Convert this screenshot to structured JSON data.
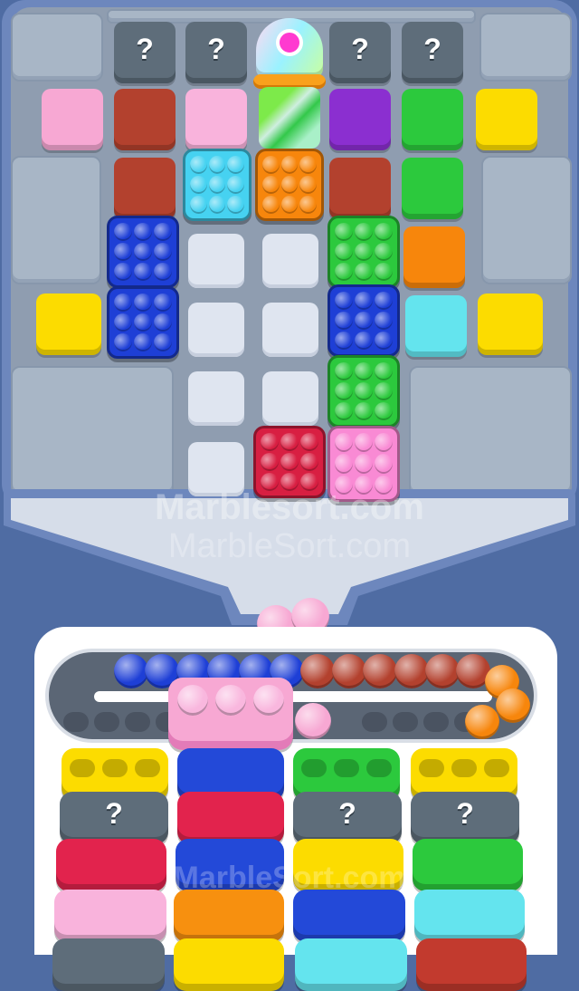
{
  "mystery_symbol": "?",
  "watermark": {
    "line1": "Marblesort.com",
    "line2": "MarbleSort.com"
  },
  "colors": {
    "pink": "#f7a8d3",
    "brown": "#b3412e",
    "light_pink": "#f9b3dc",
    "purple": "#8b2fd0",
    "green": "#2cc93d",
    "yellow": "#fcdc00",
    "cyan": "#46d2f1",
    "orange": "#f7860c",
    "blue": "#1e3fd6",
    "red": "#d81f42",
    "aqua": "#64e4ee"
  },
  "board": {
    "row0": [
      "mystery",
      "mystery",
      "spawner",
      "mystery",
      "mystery"
    ],
    "row1": [
      "pink",
      "brown",
      "light_pink",
      "spawner-tube",
      "purple",
      "green",
      "yellow"
    ],
    "row2": [
      "brown",
      "cyan-box",
      "orange-box",
      "brown",
      "green"
    ],
    "row3": [
      "blue-box",
      "empty",
      "empty",
      "green-box",
      "orange"
    ],
    "row4": [
      "yellow",
      "blue-box",
      "empty",
      "empty",
      "blue-box",
      "aqua",
      "yellow"
    ],
    "row5": [
      "empty",
      "empty",
      "green-box"
    ],
    "row6": [
      "empty",
      "red-box",
      "pink-box"
    ]
  },
  "falling_marbles": [
    "pink",
    "pink"
  ],
  "conveyor": {
    "marbles": [
      "blue",
      "blue",
      "blue",
      "blue",
      "blue",
      "blue",
      "brown",
      "brown",
      "brown",
      "brown",
      "brown",
      "brown",
      "orange",
      "orange",
      "orange"
    ],
    "holder": {
      "color": "pink",
      "capacity": 3,
      "filled": 3
    }
  },
  "columns": [
    [
      "yellow-holder",
      "mystery",
      "red",
      "light_pink"
    ],
    [
      "blue",
      "red",
      "blue",
      "orange"
    ],
    [
      "green-holder",
      "mystery",
      "yellow",
      "blue"
    ],
    [
      "yellow-holder",
      "mystery",
      "green",
      "aqua"
    ]
  ]
}
